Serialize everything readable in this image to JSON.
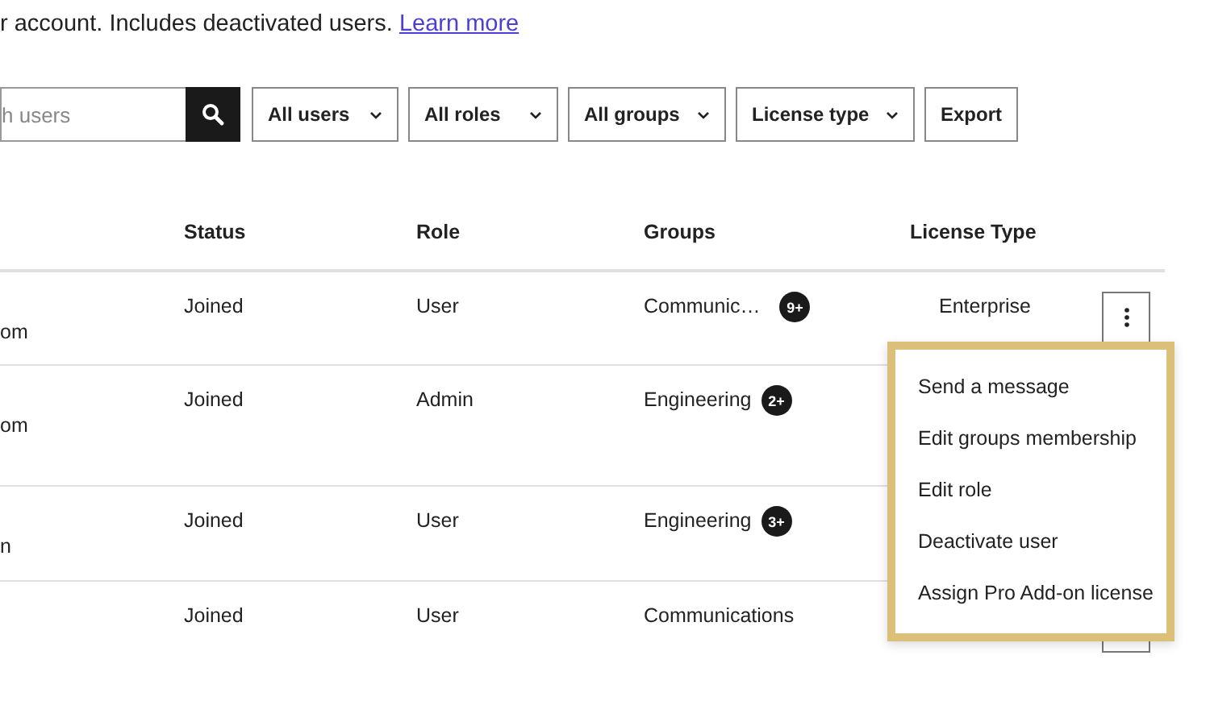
{
  "description": {
    "text": "r account. Includes deactivated users.",
    "link": "Learn more"
  },
  "search": {
    "placeholder": "h users"
  },
  "filters": [
    {
      "label": "All users",
      "kind": "dropdown"
    },
    {
      "label": "All roles",
      "kind": "dropdown"
    },
    {
      "label": "All groups",
      "kind": "dropdown"
    },
    {
      "label": "License type",
      "kind": "dropdown"
    },
    {
      "label": "Export",
      "kind": "button"
    }
  ],
  "table": {
    "columns": [
      "Status",
      "Role",
      "Groups",
      "License Type"
    ],
    "rows": [
      {
        "name": "om",
        "status": "Joined",
        "role": "User",
        "group": "Communic…",
        "group_badge": "9+",
        "license": "Enterprise",
        "menu_button": true
      },
      {
        "name": "om",
        "status": "Joined",
        "role": "Admin",
        "group": "Engineering",
        "group_badge": "2+"
      },
      {
        "name": "n",
        "status": "Joined",
        "role": "User",
        "group": "Engineering",
        "group_badge": "3+"
      },
      {
        "status": "Joined",
        "role": "User",
        "group": "Communications",
        "menu_button": true
      }
    ]
  },
  "menu": {
    "items": [
      "Send a message",
      "Edit groups membership",
      "Edit role",
      "Deactivate user",
      "Assign Pro Add-on license"
    ]
  }
}
